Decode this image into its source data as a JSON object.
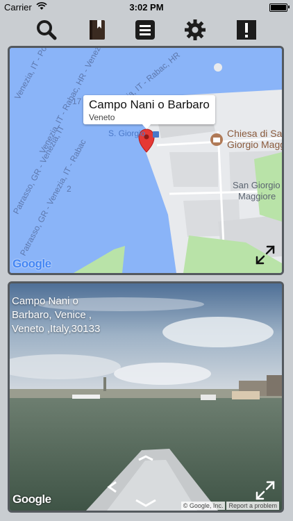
{
  "status_bar": {
    "carrier": "Carrier",
    "time": "3:02 PM"
  },
  "toolbar": {
    "icons": [
      "search-icon",
      "bookmark-book-icon",
      "list-menu-icon",
      "gear-icon",
      "alert-icon"
    ]
  },
  "map": {
    "callout_title": "Campo Nani o Barbaro",
    "callout_subtitle": "Veneto",
    "poi_name_line1": "Chiesa di San",
    "poi_name_line2": "Giorgio Maggi",
    "area_label_line1": "San Giorgio",
    "area_label_line2": "Maggiore",
    "stop_label": "S. Giorgio",
    "sea_lanes": [
      "Venezia, IT - Polari",
      "Venezia, IT - Rabac, HR - Venezia, IT",
      "Venezia, IT - Rabac, HR",
      "Patrasso, GR - Venezia, IT - Rabac",
      "Patrasso, GR - Venezia, IT"
    ],
    "lane_numbers": [
      "17",
      "2"
    ],
    "logo_text": "Google",
    "colors": {
      "water": "#8ab4f8",
      "land": "#e8eaed",
      "park": "#b9e3a8",
      "marker": "#e53935"
    }
  },
  "street_view": {
    "address_line1": "Campo Nani o",
    "address_line2": "Barbaro, Venice ,",
    "address_line3": "Veneto ,Italy,30133",
    "logo_text": "Google",
    "credit": "© Google, Inc.",
    "report_link": "Report a problem"
  }
}
